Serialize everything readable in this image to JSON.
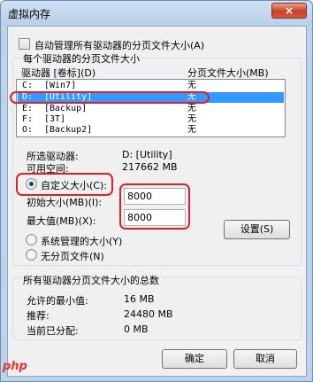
{
  "window": {
    "title": "虚拟内存",
    "close_icon": "×"
  },
  "paging": {
    "auto_manage_label": "自动管理所有驱动器的分页文件大小(A)",
    "auto_manage_checked": false,
    "group_title": "每个驱动器的分页文件大小",
    "columns": {
      "drive": "驱动器 [卷标](D)",
      "size": "分页文件大小(MB)"
    },
    "drives": [
      {
        "letter": "C:",
        "label": "[Win7]",
        "size": "无",
        "selected": false
      },
      {
        "letter": "D:",
        "label": "[Utility]",
        "size": "无",
        "selected": true
      },
      {
        "letter": "E:",
        "label": "[Backup]",
        "size": "无",
        "selected": false
      },
      {
        "letter": "F:",
        "label": "[3T]",
        "size": "无",
        "selected": false
      },
      {
        "letter": "O:",
        "label": "[Backup2]",
        "size": "无",
        "selected": false
      }
    ],
    "selected_drive_label": "所选驱动器:",
    "selected_drive_value": "D:  [Utility]",
    "free_space_label": "可用空间:",
    "free_space_value": "217662 MB",
    "custom_size_label": "自定义大小(C):",
    "initial_size_label": "初始大小(MB)(I):",
    "initial_size_value": "8000",
    "max_size_label": "最大值(MB)(X):",
    "max_size_value": "8000",
    "system_managed_label": "系统管理的大小(Y)",
    "no_paging_label": "无分页文件(N)",
    "set_button": "设置(S)",
    "size_option": "custom"
  },
  "totals": {
    "group_title": "所有驱动器分页文件大小的总数",
    "min_allowed_label": "允许的最小值:",
    "min_allowed_value": "16 MB",
    "recommended_label": "推荐:",
    "recommended_value": "24480 MB",
    "current_label": "当前已分配:",
    "current_value": "0 MB"
  },
  "footer": {
    "ok_button": "确定",
    "cancel_button": "取消"
  },
  "colors": {
    "highlight": "#e01f2a",
    "selection": "#3399ff",
    "window_frame": "#bcd3ea"
  },
  "watermark": "php"
}
